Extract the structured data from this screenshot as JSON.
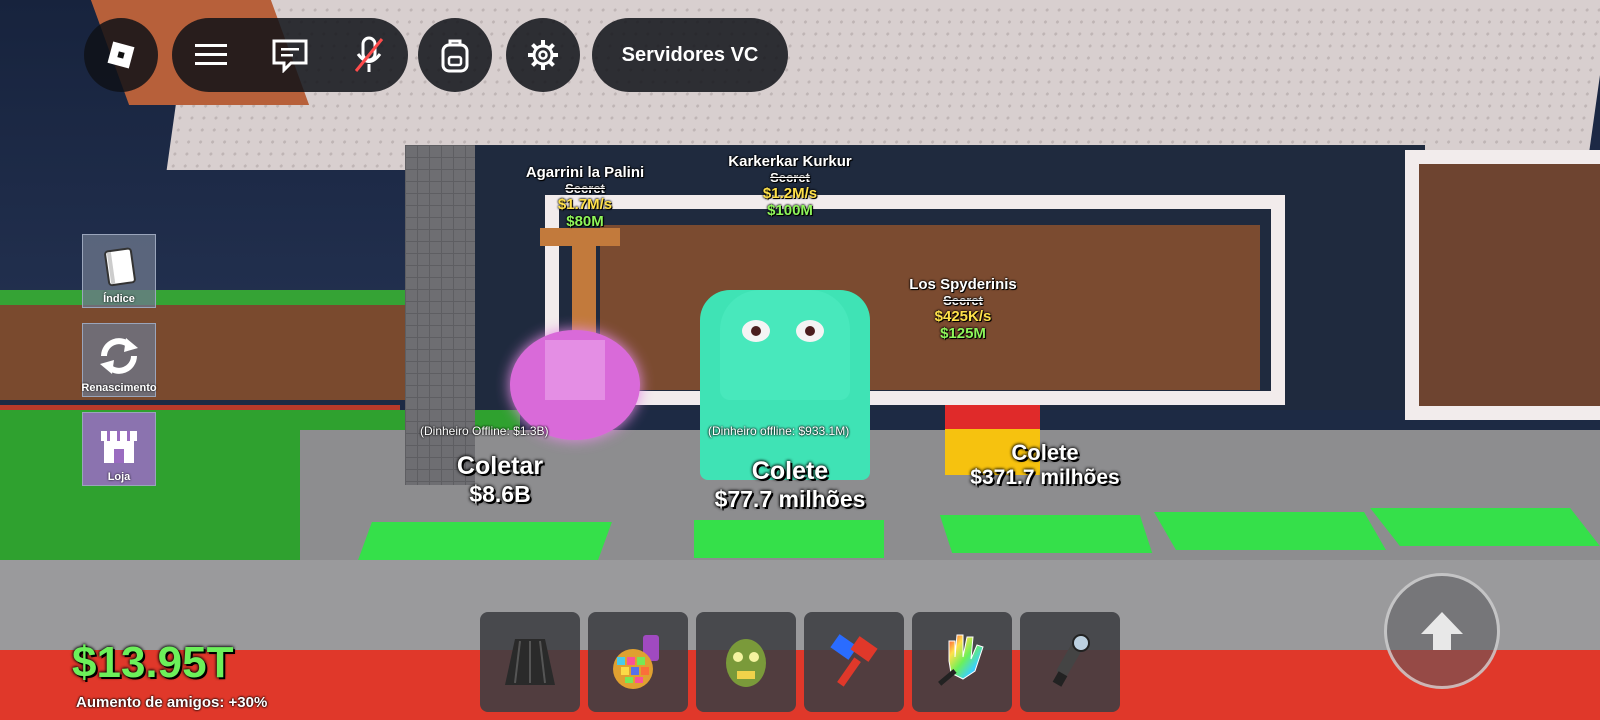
{
  "topbar": {
    "roblox_icon": "roblox-logo-icon",
    "menu_icon": "hamburger-menu-icon",
    "chat_icon": "chat-icon",
    "mic_icon": "microphone-muted-icon",
    "backpack_icon": "backpack-icon",
    "settings_icon": "gear-icon",
    "servers_label": "Servidores VC"
  },
  "side_menu": [
    {
      "label": "Índice",
      "icon": "book-icon"
    },
    {
      "label": "Renascimento",
      "icon": "refresh-icon"
    },
    {
      "label": "Loja",
      "icon": "store-icon"
    }
  ],
  "pets": [
    {
      "name": "Agarrini la Palini",
      "rarity": "Secret",
      "rate": "$1.7M/s",
      "price": "$80M"
    },
    {
      "name": "Karkerkar Kurkur",
      "rarity": "Secret",
      "rate": "$1.2M/s",
      "price": "$100M"
    },
    {
      "name": "Los Spyderinis",
      "rarity": "Secret",
      "rate": "$425K/s",
      "price": "$125M"
    }
  ],
  "collectors": [
    {
      "offline": "(Dinheiro Offline: $1.3B)",
      "label": "Coletar",
      "amount": "$8.6B"
    },
    {
      "offline": "(Dinheiro offline: $933.1M)",
      "label": "Colete",
      "amount": "$77.7 milhões"
    },
    {
      "offline": "",
      "label": "Colete",
      "amount": "$371.7 milhões"
    }
  ],
  "hud": {
    "money": "$13.95T",
    "friend_boost": "Aumento de amigos: +30%"
  },
  "hotbar": [
    {
      "icon": "black-cape-icon"
    },
    {
      "icon": "disco-ball-icon"
    },
    {
      "icon": "zombie-head-icon"
    },
    {
      "icon": "blue-red-hammer-icon"
    },
    {
      "icon": "rainbow-glove-icon"
    },
    {
      "icon": "flashlight-icon"
    }
  ],
  "jump_icon": "jump-arrow-icon",
  "colors": {
    "money": "#6cf05a",
    "pad": "#35e04a",
    "rate": "#ffe14a",
    "price": "#8ef55a"
  }
}
